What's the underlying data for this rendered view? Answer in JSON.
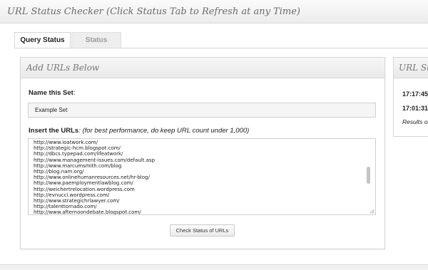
{
  "header": {
    "title": "URL Status Checker (Click Status Tab to Refresh at any Time)"
  },
  "tabs": [
    {
      "label": "Query Status",
      "active": true
    },
    {
      "label": "Status",
      "active": false
    }
  ],
  "add_panel": {
    "title": "Add URLs Below",
    "name_label": "Name this Set",
    "name_colon": ":",
    "name_value": "Example Set",
    "urls_label": "Insert the URLs",
    "urls_hint": ": (for best performance, do keep URL count under 1,000)",
    "urls": [
      "http://www.ioatwork.com/",
      "http://strategic-hcm.blogspot.com/",
      "http://dbcs.typepad.com/lifeatwork/",
      "http://www.management-issues.com/default.asp",
      "http://www.marcumsmith.com/blog",
      "http://blog.nam.org/",
      "http://www.onlinehumanresources.net/hr-blog/",
      "http://www.paemploymentlawblog.com/",
      "http://weichertrelocation.wordpress.com",
      "http://evnucci.wordpress.com/",
      "http://www.strategichrlawyer.com/",
      "http://talenttornado.com/",
      "http://www.afternoondebate.blogspot.com/"
    ],
    "scroll_position": 0.48,
    "check_button": "Check Status of URLs"
  },
  "status_panel": {
    "title": "URL Sta",
    "timestamps": [
      "17:17:45",
      "17:01:31"
    ],
    "results_text": "Results of"
  },
  "icons": {
    "resize": "resize-grip-icon"
  },
  "colors": {
    "background": "#f1f1f1",
    "panel_header": "#ececec",
    "title_text": "#6a6a6a",
    "scroll_thumb": "#c4c4c4"
  }
}
